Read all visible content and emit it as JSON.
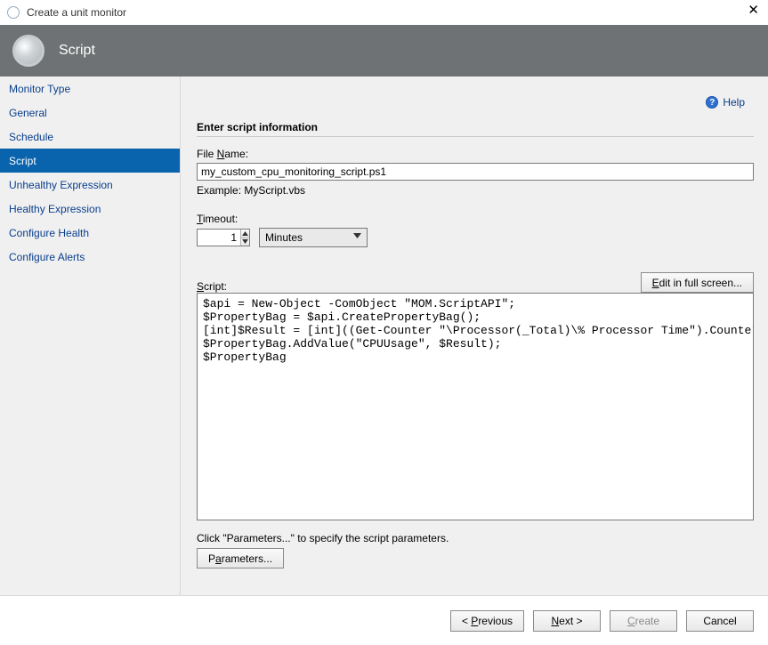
{
  "window": {
    "title": "Create a unit monitor",
    "close_glyph": "✕"
  },
  "header": {
    "title": "Script"
  },
  "help": {
    "label": "Help",
    "icon_glyph": "?"
  },
  "sidebar": {
    "items": [
      {
        "label": "Monitor Type",
        "selected": false
      },
      {
        "label": "General",
        "selected": false
      },
      {
        "label": "Schedule",
        "selected": false
      },
      {
        "label": "Script",
        "selected": true
      },
      {
        "label": "Unhealthy Expression",
        "selected": false
      },
      {
        "label": "Healthy Expression",
        "selected": false
      },
      {
        "label": "Configure Health",
        "selected": false
      },
      {
        "label": "Configure Alerts",
        "selected": false
      }
    ]
  },
  "main": {
    "section_title": "Enter script information",
    "file_name": {
      "label_pre": "File ",
      "label_key": "N",
      "label_post": "ame:",
      "value": "my_custom_cpu_monitoring_script.ps1",
      "example": "Example:  MyScript.vbs"
    },
    "timeout": {
      "label_key": "T",
      "label_post": "imeout:",
      "value": "1",
      "unit_selected": "Minutes"
    },
    "script": {
      "label_key": "S",
      "label_post": "cript:",
      "edit_button_pre": "",
      "edit_button_key": "E",
      "edit_button_post": "dit in full screen...",
      "content": "$api = New-Object -ComObject \"MOM.ScriptAPI\";\n$PropertyBag = $api.CreatePropertyBag();\n[int]$Result = [int]((Get-Counter \"\\Processor(_Total)\\% Processor Time\").CounterSamples | Select-Object -ExpandProperty CookedValue);\n$PropertyBag.AddValue(\"CPUUsage\", $Result);\n$PropertyBag"
    },
    "params": {
      "hint": "Click \"Parameters...\" to specify the script parameters.",
      "button_pre": "P",
      "button_key": "a",
      "button_post": "rameters..."
    }
  },
  "footer": {
    "previous_pre": "< ",
    "previous_key": "P",
    "previous_post": "revious",
    "next_pre": "",
    "next_key": "N",
    "next_post": "ext >",
    "create_key": "C",
    "create_post": "reate",
    "cancel": "Cancel"
  }
}
